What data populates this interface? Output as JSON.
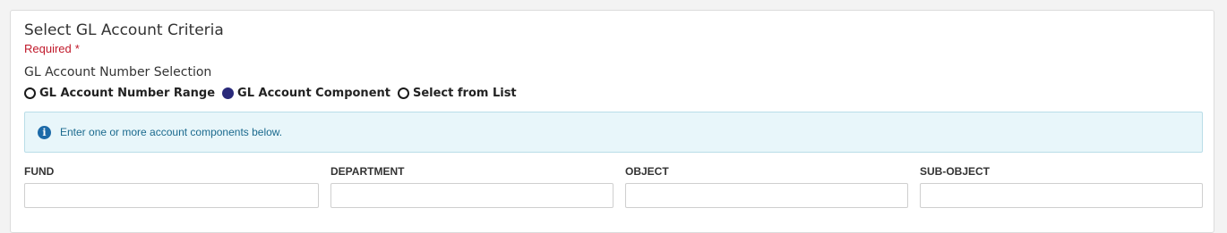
{
  "section": {
    "title": "Select GL Account Criteria",
    "required_label": "Required",
    "required_marker": "*",
    "selection_label": "GL Account Number Selection"
  },
  "radios": {
    "range": "GL Account Number Range",
    "component": "GL Account Component",
    "list": "Select from List",
    "selected": "GL Account Component"
  },
  "info": {
    "icon": "info-icon",
    "message": "Enter one or more account components below."
  },
  "fields": {
    "fund": {
      "label": "FUND",
      "value": ""
    },
    "department": {
      "label": "DEPARTMENT",
      "value": ""
    },
    "object": {
      "label": "OBJECT",
      "value": ""
    },
    "sub_object": {
      "label": "SUB-OBJECT",
      "value": ""
    }
  },
  "colors": {
    "required": "#c0182a",
    "info_bg": "#e8f6fa",
    "info_text": "#1b6a8e",
    "info_icon": "#1c6aa8",
    "radio_selected": "#2a2a7a"
  }
}
